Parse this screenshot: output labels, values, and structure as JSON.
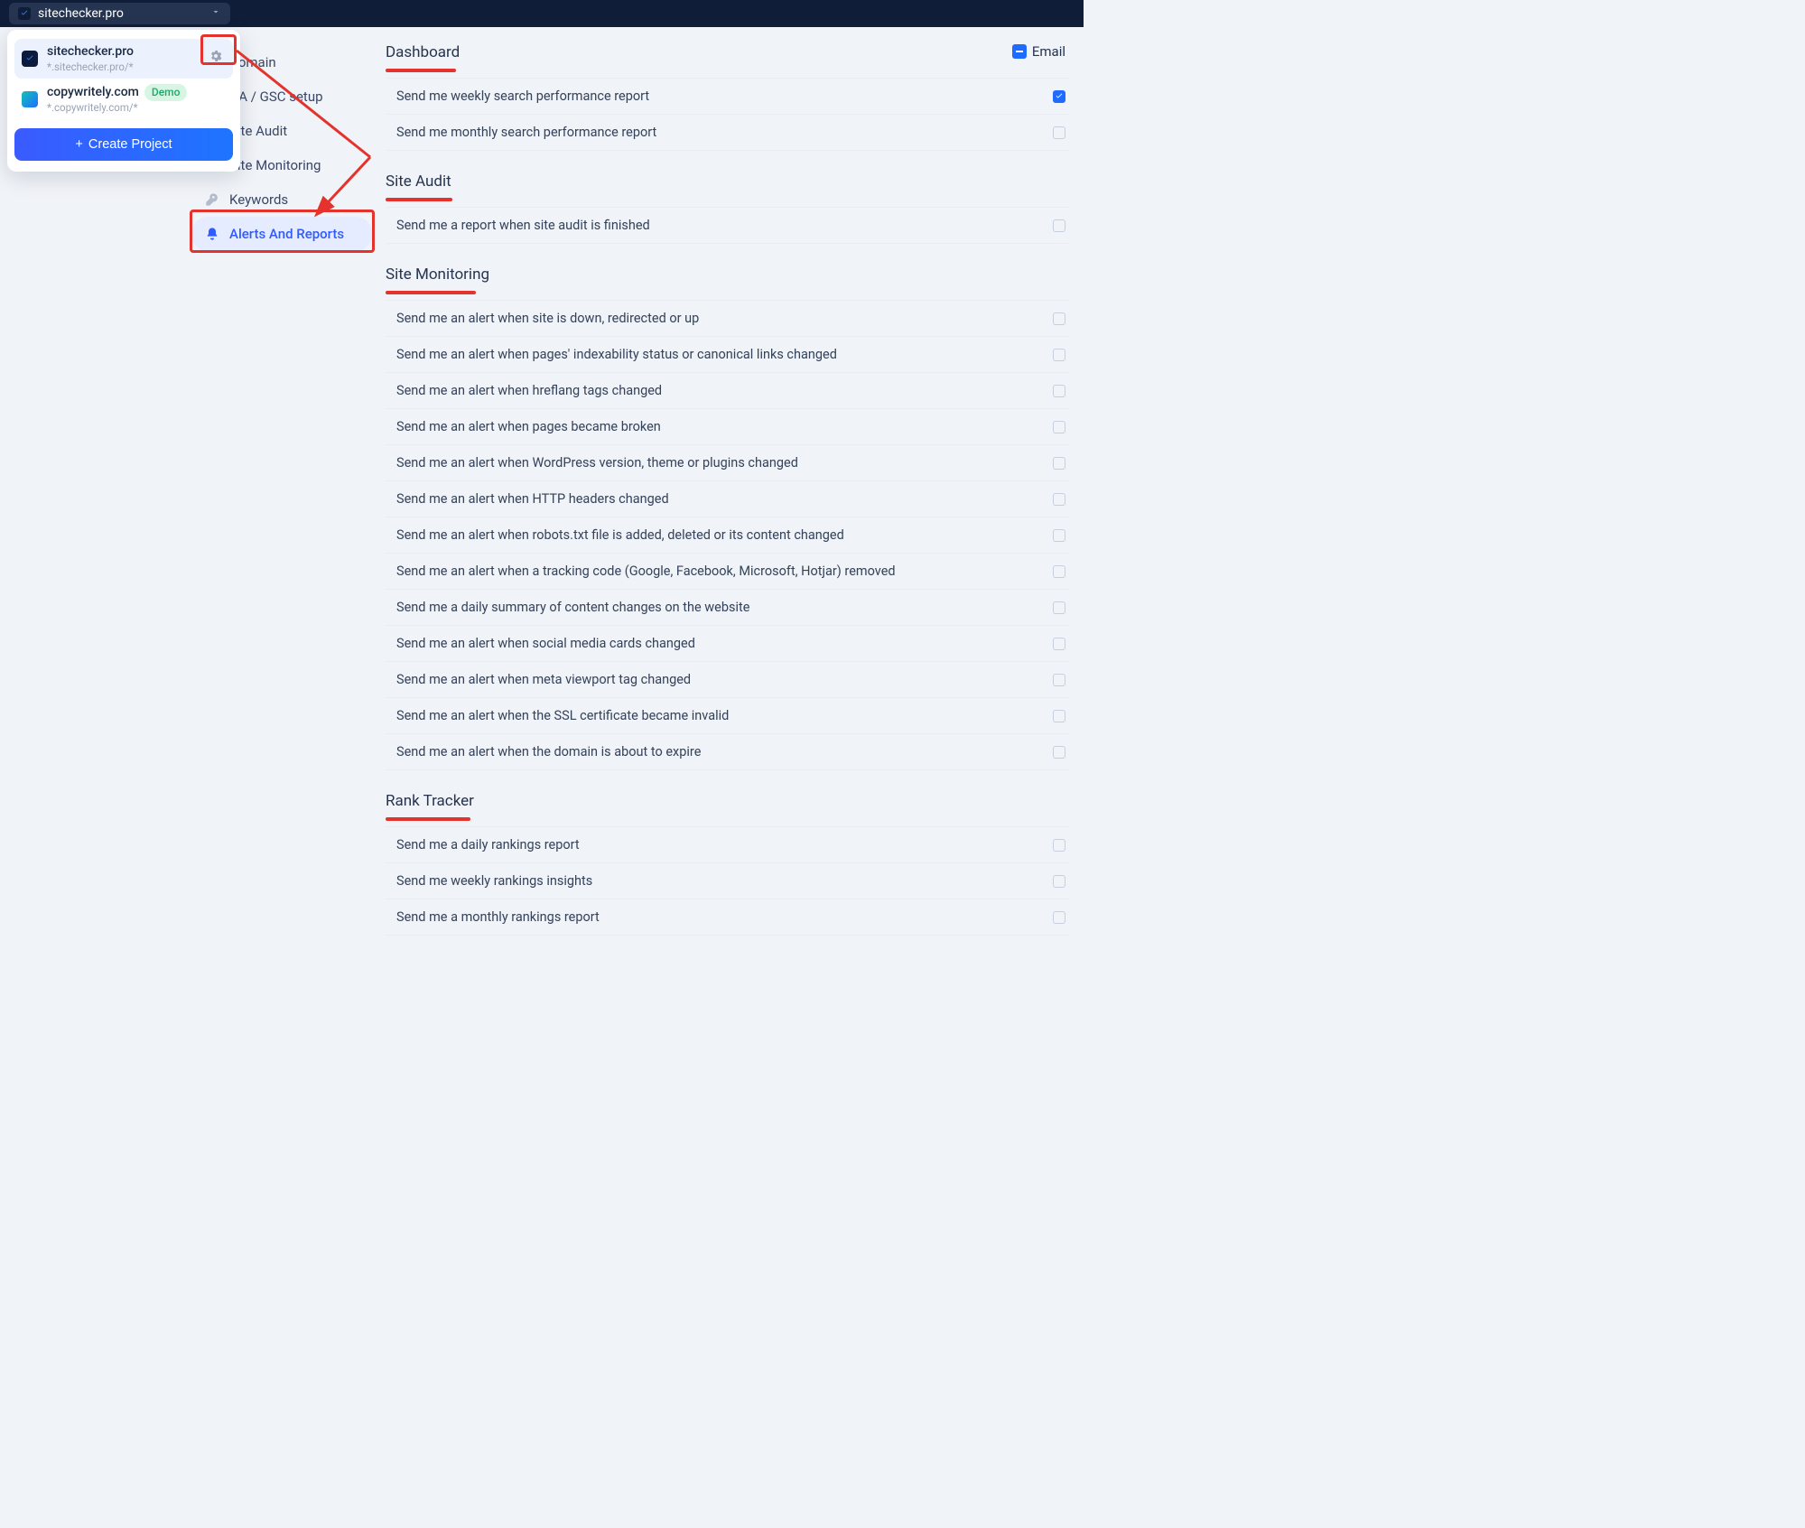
{
  "topbar": {
    "current_site": "sitechecker.pro"
  },
  "projects_dropdown": {
    "items": [
      {
        "name": "sitechecker.pro",
        "pattern": "*.sitechecker.pro/*",
        "demo": false
      },
      {
        "name": "copywritely.com",
        "pattern": "*.copywritely.com/*",
        "demo": true
      }
    ],
    "demo_label": "Demo",
    "create_label": "Create Project"
  },
  "sidenav": {
    "items": [
      {
        "label": "Domain"
      },
      {
        "label": "GA / GSC setup"
      },
      {
        "label": "Site Audit"
      },
      {
        "label": "Site Monitoring"
      },
      {
        "label": "Keywords"
      },
      {
        "label": "Alerts And Reports"
      }
    ]
  },
  "email_header": "Email",
  "sections": [
    {
      "title": "Dashboard",
      "underline_width": 78,
      "rows": [
        {
          "label": "Send me weekly search performance report",
          "checked": true
        },
        {
          "label": "Send me monthly search performance report",
          "checked": false
        }
      ]
    },
    {
      "title": "Site Audit",
      "underline_width": 74,
      "rows": [
        {
          "label": "Send me a report when site audit is finished",
          "checked": false
        }
      ]
    },
    {
      "title": "Site Monitoring",
      "underline_width": 100,
      "rows": [
        {
          "label": "Send me an alert when site is down, redirected or up",
          "checked": false
        },
        {
          "label": "Send me an alert when pages' indexability status or canonical links changed",
          "checked": false
        },
        {
          "label": "Send me an alert when hreflang tags changed",
          "checked": false
        },
        {
          "label": "Send me an alert when pages became broken",
          "checked": false
        },
        {
          "label": "Send me an alert when WordPress version, theme or plugins changed",
          "checked": false
        },
        {
          "label": "Send me an alert when HTTP headers changed",
          "checked": false
        },
        {
          "label": "Send me an alert when robots.txt file is added, deleted or its content changed",
          "checked": false
        },
        {
          "label": "Send me an alert when a tracking code (Google, Facebook, Microsoft, Hotjar) removed",
          "checked": false
        },
        {
          "label": "Send me a daily summary of content changes on the website",
          "checked": false
        },
        {
          "label": "Send me an alert when social media cards changed",
          "checked": false
        },
        {
          "label": "Send me an alert when meta viewport tag changed",
          "checked": false
        },
        {
          "label": "Send me an alert when the SSL certificate became invalid",
          "checked": false
        },
        {
          "label": "Send me an alert when the domain is about to expire",
          "checked": false
        }
      ]
    },
    {
      "title": "Rank Tracker",
      "underline_width": 94,
      "rows": [
        {
          "label": "Send me a daily rankings report",
          "checked": false
        },
        {
          "label": "Send me weekly rankings insights",
          "checked": false
        },
        {
          "label": "Send me a monthly rankings report",
          "checked": false
        }
      ]
    }
  ]
}
